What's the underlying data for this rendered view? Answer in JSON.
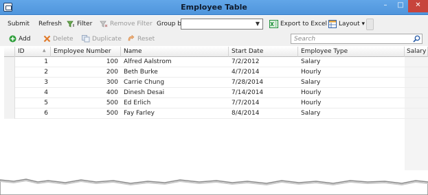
{
  "window": {
    "title": "Employee Table",
    "controls": {
      "minimize": "–",
      "maximize": "□",
      "close": "✕"
    }
  },
  "toolbar": {
    "submit": "Submit",
    "refresh": "Refresh",
    "filter": "Filter",
    "remove_filter": "Remove Filter",
    "group_by_label": "Group by",
    "group_by_value": "",
    "export": "Export to Excel",
    "layout": "Layout",
    "layout_caret": "▾"
  },
  "actions": {
    "add": "Add",
    "delete": "Delete",
    "duplicate": "Duplicate",
    "reset": "Reset"
  },
  "search": {
    "placeholder": "Search",
    "value": ""
  },
  "grid": {
    "columns": [
      "ID",
      "Employee Number",
      "Name",
      "Start Date",
      "Employee Type",
      "Salary"
    ],
    "rows": [
      {
        "id": "1",
        "number": "100",
        "name": "Alfred Aalstrom",
        "start": "7/2/2012",
        "type": "Salary"
      },
      {
        "id": "2",
        "number": "200",
        "name": "Beth Burke",
        "start": "4/7/2014",
        "type": "Hourly"
      },
      {
        "id": "3",
        "number": "300",
        "name": "Carrie Chung",
        "start": "7/28/2014",
        "type": "Salary"
      },
      {
        "id": "4",
        "number": "400",
        "name": "Dinesh Desai",
        "start": "7/14/2014",
        "type": "Hourly"
      },
      {
        "id": "5",
        "number": "500",
        "name": "Ed Erlich",
        "start": "7/7/2014",
        "type": "Hourly"
      },
      {
        "id": "6",
        "number": "500",
        "name": "Fay Farley",
        "start": "8/4/2014",
        "type": "Salary"
      }
    ]
  },
  "icons": {
    "filter": "funnel-icon",
    "remove_filter": "funnel-remove-icon",
    "export": "excel-icon",
    "layout": "layout-icon",
    "add": "plus-circle-icon",
    "delete": "x-icon",
    "duplicate": "duplicate-icon",
    "reset": "reset-icon",
    "search": "search-icon"
  },
  "colors": {
    "titlebar": "#5a9fe4",
    "close_button": "#c7443c",
    "add_green": "#2e9e3a",
    "delete_orange": "#e07a2a",
    "excel_green": "#1f8f3a"
  }
}
